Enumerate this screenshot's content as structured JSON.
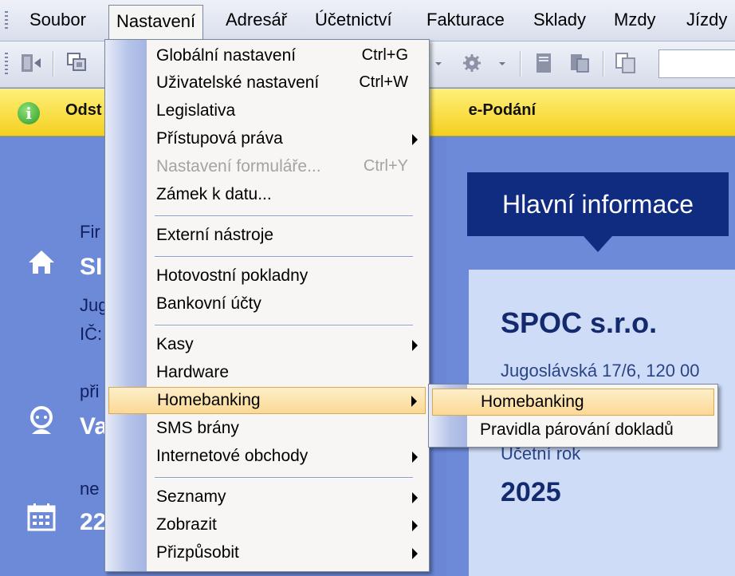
{
  "menubar": {
    "items": [
      {
        "label": "Soubor"
      },
      {
        "label": "Nastavení"
      },
      {
        "label": "Adresář"
      },
      {
        "label": "Účetnictví"
      },
      {
        "label": "Fakturace"
      },
      {
        "label": "Sklady"
      },
      {
        "label": "Mzdy"
      },
      {
        "label": "Jízdy"
      }
    ]
  },
  "infobar": {
    "text_left": "Odst",
    "text_right": "e-Podání",
    "icon": "info-icon"
  },
  "leftpanel": {
    "firma_label": "Fir",
    "firma_name": "SI",
    "addr_line": "Jug",
    "ic_line": "IČ:",
    "user_label": "při",
    "user_name": "Va",
    "date_label": "ne",
    "date_value": "22"
  },
  "right": {
    "tab_title": "Hlavní informace",
    "firm_name": "SPOC s.r.o.",
    "firm_address": "Jugoslávská 17/6, 120 00",
    "ucetni_label": "Účetní rok",
    "ucetni_year": "2025"
  },
  "menu": {
    "items": [
      {
        "label": "Globální nastavení",
        "shortcut": "Ctrl+G"
      },
      {
        "label": "Uživatelské nastavení",
        "shortcut": "Ctrl+W"
      },
      {
        "label": "Legislativa"
      },
      {
        "label": "Přístupová práva"
      },
      {
        "label": "Nastavení formuláře...",
        "shortcut": "Ctrl+Y"
      },
      {
        "label": "Zámek k datu..."
      },
      {
        "label": "Externí nástroje"
      },
      {
        "label": "Hotovostní pokladny"
      },
      {
        "label": "Bankovní účty"
      },
      {
        "label": "Kasy"
      },
      {
        "label": "Hardware"
      },
      {
        "label": "Homebanking"
      },
      {
        "label": "SMS brány"
      },
      {
        "label": "Internetové obchody"
      },
      {
        "label": "Seznamy"
      },
      {
        "label": "Zobrazit"
      },
      {
        "label": "Přizpůsobit"
      }
    ]
  },
  "submenu": {
    "items": [
      {
        "label": "Homebanking"
      },
      {
        "label": "Pravidla párování dokladů"
      }
    ]
  },
  "colors": {
    "menu_highlight": "#fbd995",
    "info_bar": "#f4d020",
    "panel_blue": "#6d8ad8",
    "tab_navy": "#0f2c80"
  }
}
